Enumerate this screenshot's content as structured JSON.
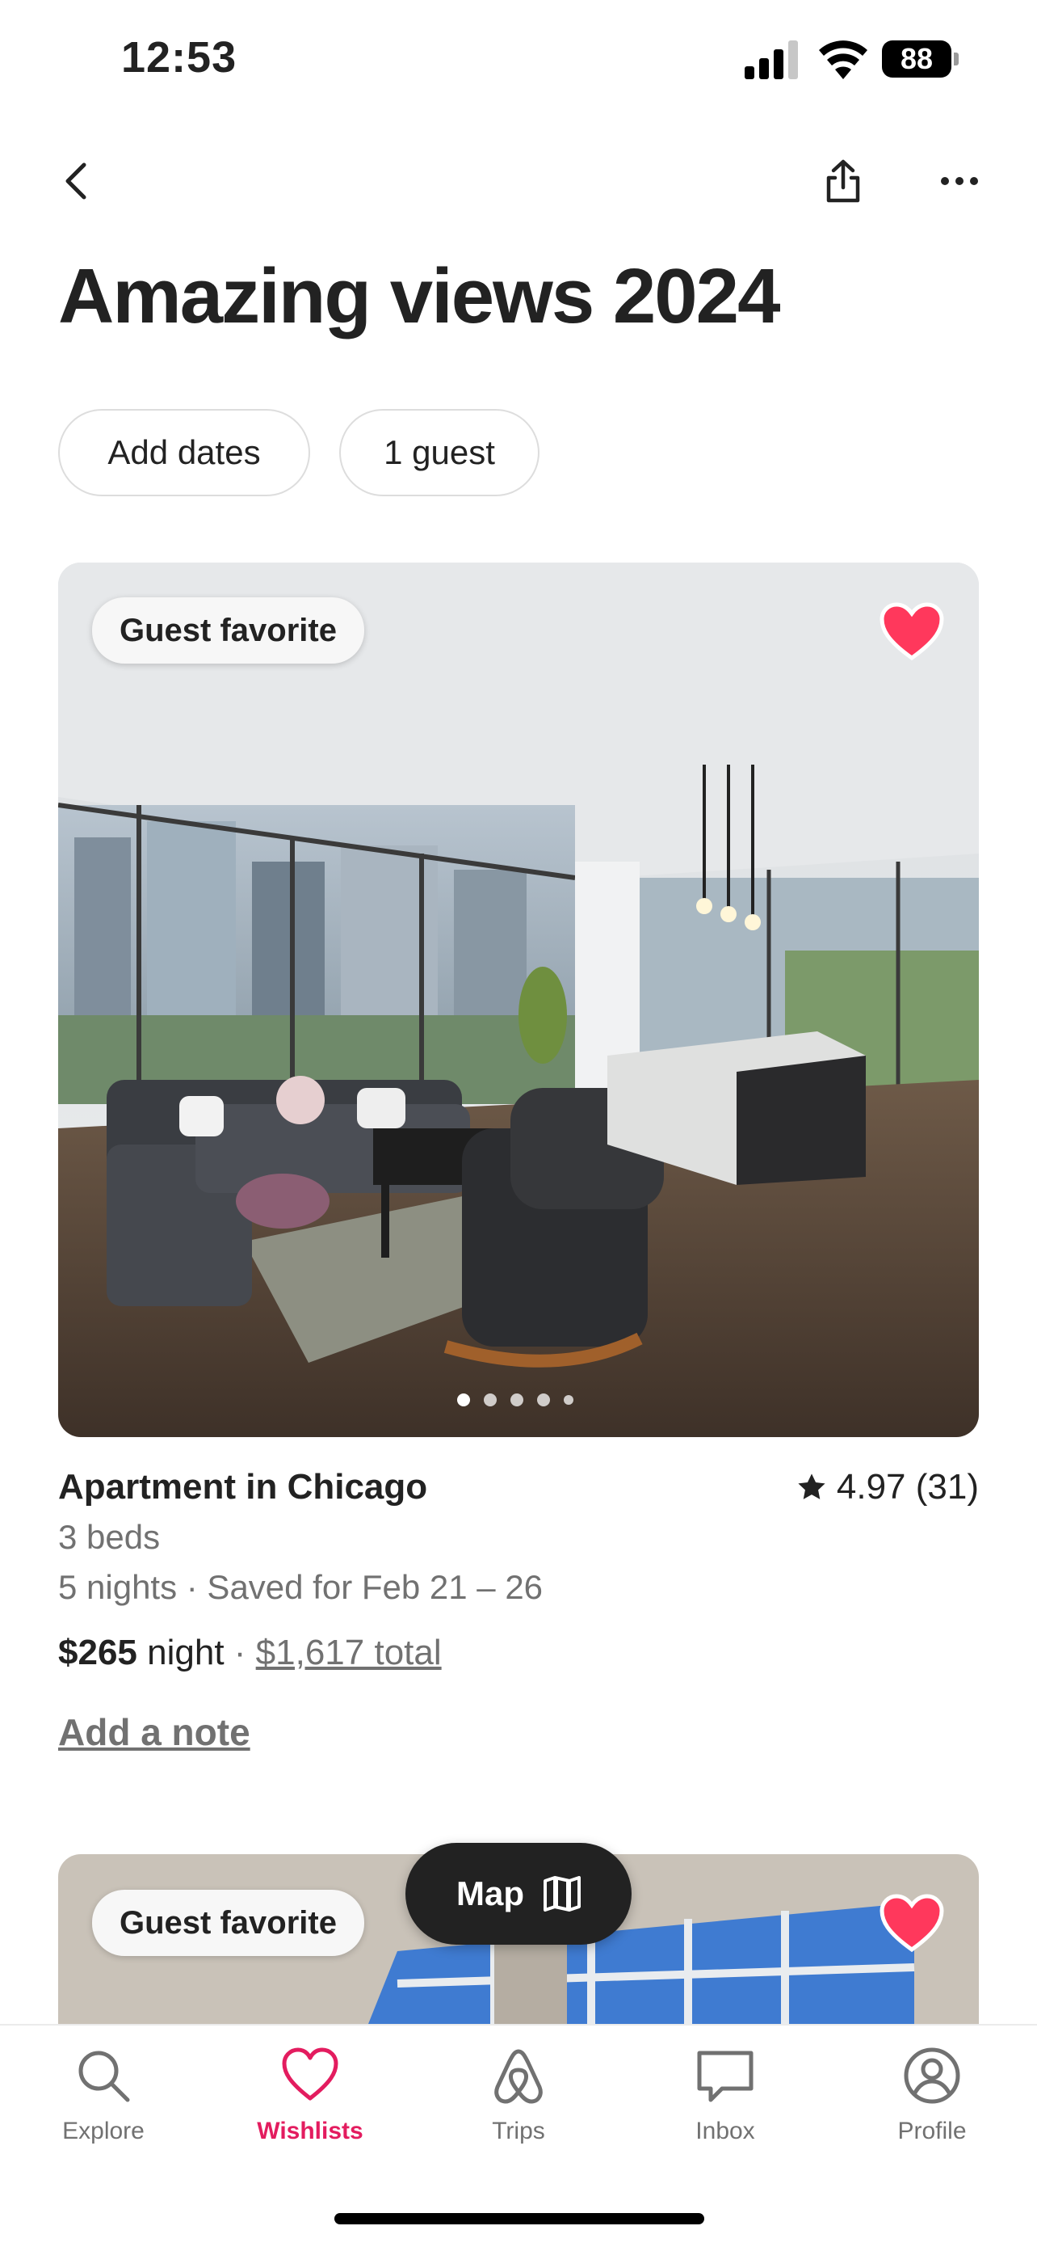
{
  "status_bar": {
    "time": "12:53",
    "battery": "88"
  },
  "page": {
    "title": "Amazing views 2024"
  },
  "filters": {
    "dates": "Add dates",
    "guests": "1 guest"
  },
  "listings": [
    {
      "badge": "Guest favorite",
      "title": "Apartment in Chicago",
      "rating": "4.97 (31)",
      "beds": "3 beds",
      "stay": "5 nights · Saved for Feb 21 – 26",
      "price": "$265",
      "price_unit": "night",
      "separator": "·",
      "total": "$1,617 total",
      "note_link": "Add a note",
      "photo_count": 5,
      "active_photo": 1
    },
    {
      "badge": "Guest favorite"
    }
  ],
  "map_button": {
    "label": "Map"
  },
  "tabs": [
    {
      "label": "Explore",
      "icon": "search-icon"
    },
    {
      "label": "Wishlists",
      "icon": "heart-icon",
      "active": true
    },
    {
      "label": "Trips",
      "icon": "airbnb-logo-icon"
    },
    {
      "label": "Inbox",
      "icon": "message-icon"
    },
    {
      "label": "Profile",
      "icon": "profile-icon"
    }
  ],
  "colors": {
    "accent": "#e31c5f",
    "heart": "#ff385c",
    "text": "#222222",
    "muted": "#717171"
  }
}
